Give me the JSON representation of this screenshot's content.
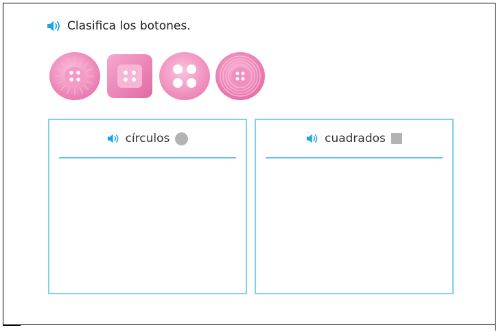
{
  "instruction": {
    "text": "Clasifica los botones.",
    "audio_icon": "speaker-icon"
  },
  "colors": {
    "accent_blue": "#1aa6e6",
    "bin_border": "#7fd0ee",
    "button_pink": "#f08fbd",
    "shape_gray": "#b3b3b3"
  },
  "draggable_buttons": [
    {
      "shape": "circle",
      "style": "sunburst"
    },
    {
      "shape": "square",
      "style": "rounded-square"
    },
    {
      "shape": "circle",
      "style": "large-holes"
    },
    {
      "shape": "circle",
      "style": "concentric-rings"
    }
  ],
  "bins": [
    {
      "label": "círculos",
      "shape_icon": "gray-circle-icon",
      "audio_icon": "speaker-icon"
    },
    {
      "label": "cuadrados",
      "shape_icon": "gray-square-icon",
      "audio_icon": "speaker-icon"
    }
  ]
}
